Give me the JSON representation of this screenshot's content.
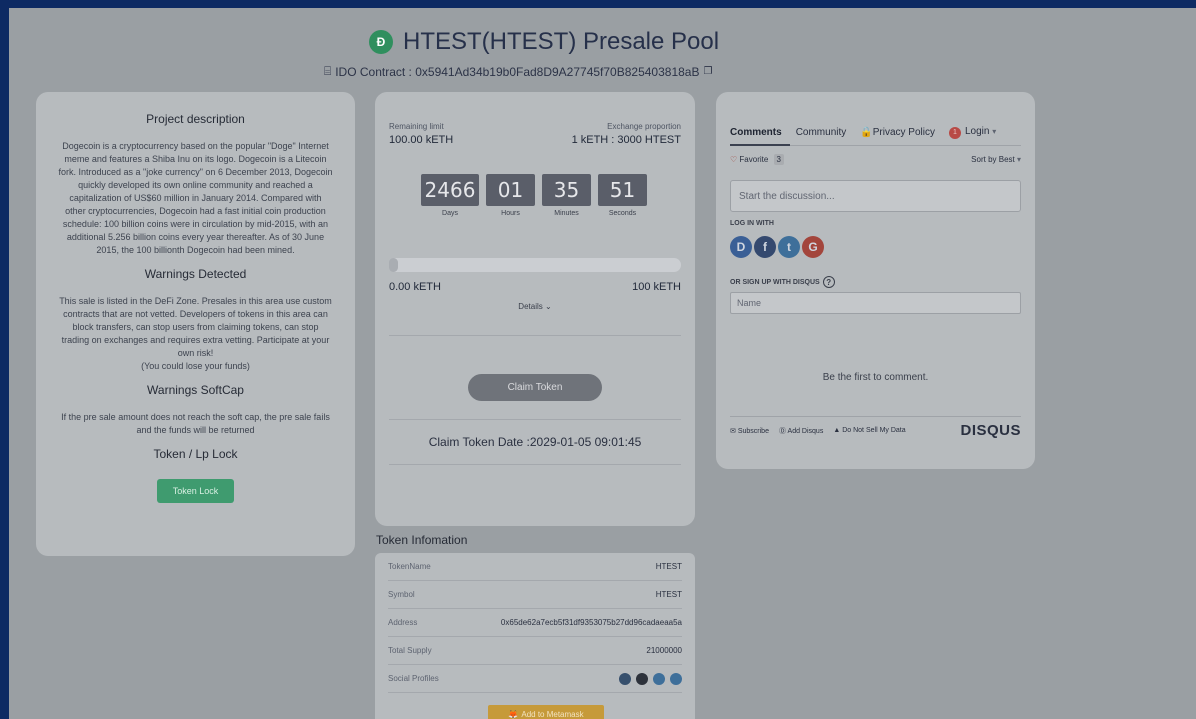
{
  "header": {
    "logo_glyph": "Ð",
    "title": "HTEST(HTEST) Presale Pool",
    "contract_label": "IDO Contract : 0x5941Ad34b19b0Fad8D9A27745f70B825403818aB",
    "contract_icon": "contract-icon",
    "copy_icon": "copy-icon"
  },
  "left": {
    "project_title": "Project description",
    "project_text": "Dogecoin is a cryptocurrency based on the popular \"Doge\" Internet meme and features a Shiba Inu on its logo. Dogecoin is a Litecoin fork. Introduced as a \"joke currency\" on 6 December 2013, Dogecoin quickly developed its own online community and reached a capitalization of US$60 million in January 2014. Compared with other cryptocurrencies, Dogecoin had a fast initial coin production schedule: 100 billion coins were in circulation by mid-2015, with an additional 5.256 billion coins every year thereafter. As of 30 June 2015, the 100 billionth Dogecoin had been mined.",
    "warnings_title": "Warnings Detected",
    "warnings_text": "This sale is listed in the DeFi Zone. Presales in this area use custom contracts that are not vetted. Developers of tokens in this area can block transfers, can stop users from claiming tokens, can stop trading on exchanges and requires extra vetting. Participate at your own risk!",
    "warnings_text2": "(You could lose your funds)",
    "softcap_title": "Warnings SoftCap",
    "softcap_text": "If the pre sale amount does not reach the soft cap, the pre sale fails and the funds will be returned",
    "lock_title": "Token / Lp Lock",
    "lock_button": "Token Lock"
  },
  "presale": {
    "remaining_label": "Remaining limit",
    "remaining_value": "100.00 kETH",
    "exchange_label": "Exchange proportion",
    "exchange_value": "1 kETH : 3000 HTEST",
    "countdown": {
      "days": "2466",
      "hours": "01",
      "minutes": "35",
      "seconds": "51",
      "days_label": "Days",
      "hours_label": "Hours",
      "minutes_label": "Minutes",
      "seconds_label": "Seconds"
    },
    "progress_percent": 0,
    "raised": "0.00 kETH",
    "cap": "100 kETH",
    "details_label": "Details",
    "claim_button": "Claim Token",
    "claim_date": "Claim Token Date :2029-01-05 09:01:45"
  },
  "token_info": {
    "title": "Token Infomation",
    "rows": [
      {
        "key": "TokenName",
        "value": "HTEST"
      },
      {
        "key": "Symbol",
        "value": "HTEST"
      },
      {
        "key": "Address",
        "value": "0x65de62a7ecb5f31df9353075b27dd96cadaeaa5a"
      },
      {
        "key": "Total Supply",
        "value": "21000000"
      }
    ],
    "social_label": "Social Profiles",
    "social_icons": [
      "globe-icon",
      "github-icon",
      "twitter-icon",
      "telegram-icon"
    ],
    "metamask_button": "Add to Metamask"
  },
  "disqus": {
    "tab_comments": "Comments",
    "tab_community": "Community",
    "privacy": "Privacy Policy",
    "notif_count": "1",
    "login": "Login",
    "favorite": "Favorite",
    "favorite_count": "3",
    "sort": "Sort by Best",
    "discussion_placeholder": "Start the discussion...",
    "login_with": "LOG IN WITH",
    "signup_label": "OR SIGN UP WITH DISQUS",
    "name_placeholder": "Name",
    "empty_text": "Be the first to comment.",
    "subscribe": "Subscribe",
    "add_disqus": "Add Disqus",
    "do_not_sell": "Do Not Sell My Data",
    "brand": "DISQUS",
    "login_icons": [
      {
        "letter": "D",
        "color": "#3a5f96"
      },
      {
        "letter": "f",
        "color": "#34496f"
      },
      {
        "letter": "t",
        "color": "#3e6f9a"
      },
      {
        "letter": "G",
        "color": "#a3453c"
      }
    ]
  }
}
